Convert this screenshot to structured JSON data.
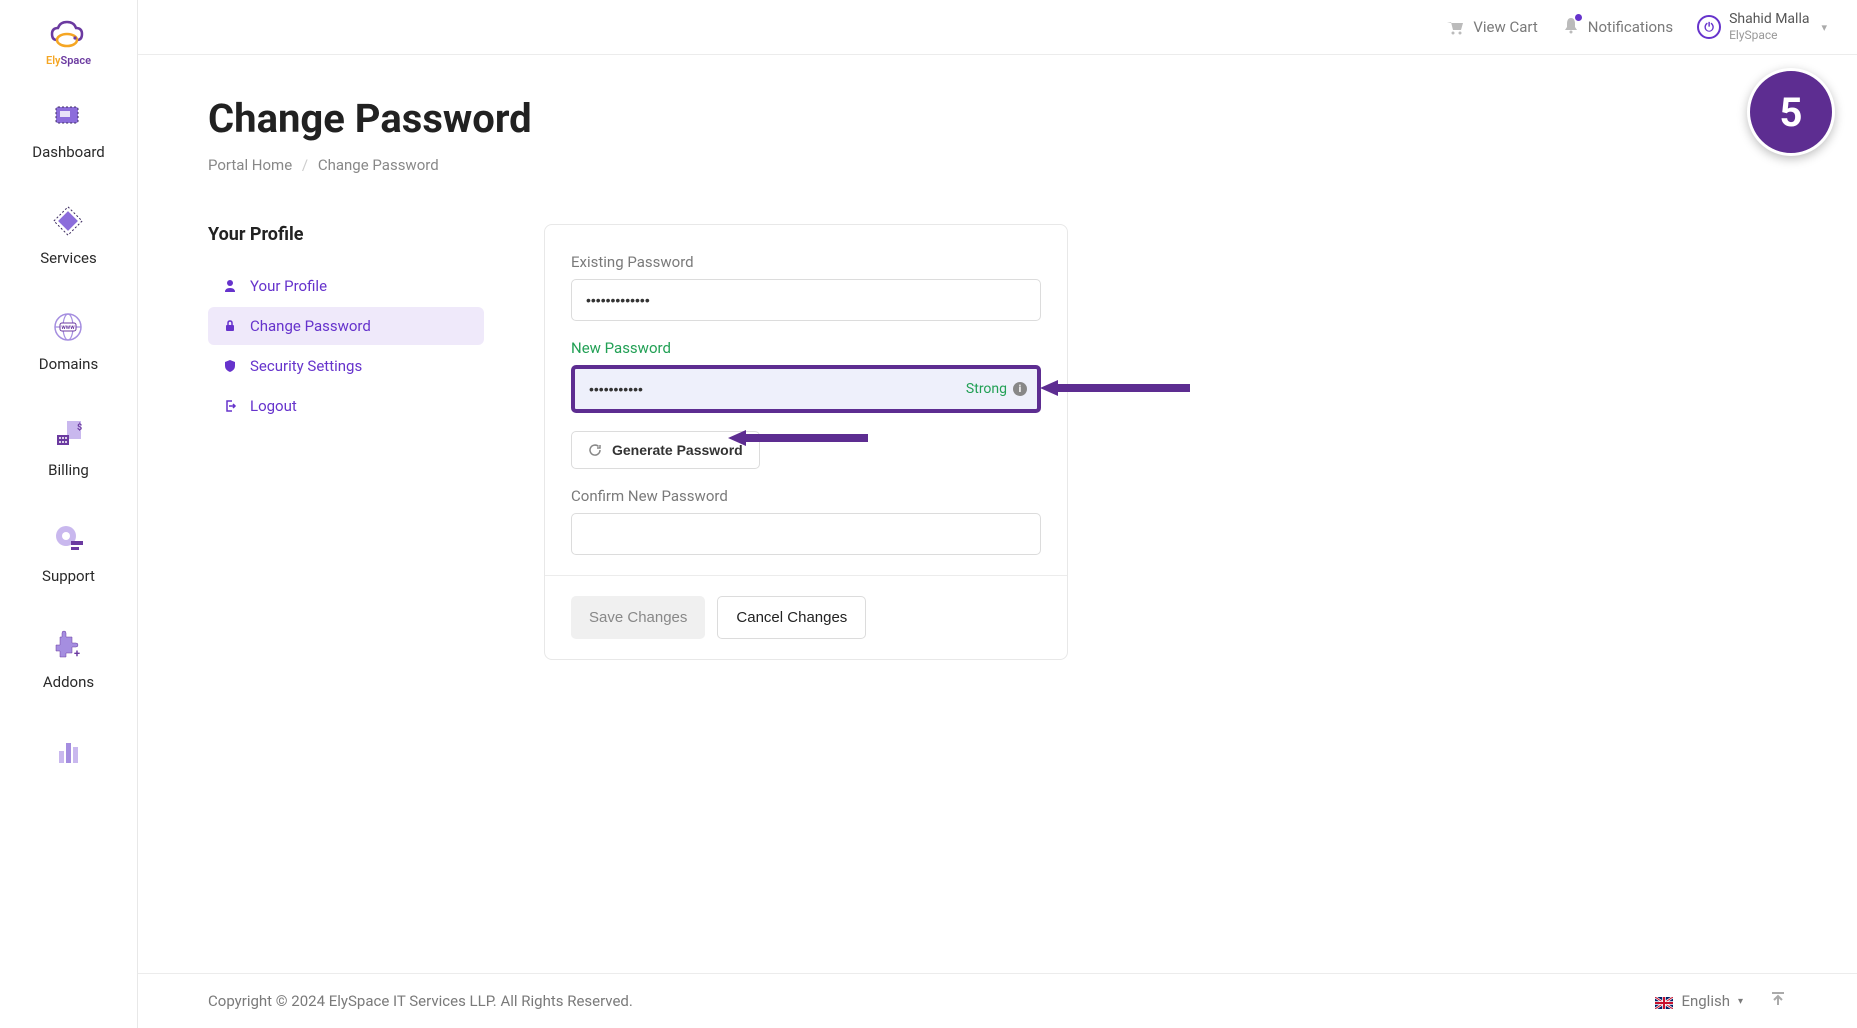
{
  "brand": {
    "name": "ElySpace"
  },
  "sidebar": {
    "items": [
      {
        "label": "Dashboard"
      },
      {
        "label": "Services"
      },
      {
        "label": "Domains"
      },
      {
        "label": "Billing"
      },
      {
        "label": "Support"
      },
      {
        "label": "Addons"
      }
    ]
  },
  "topbar": {
    "view_cart": "View Cart",
    "notifications": "Notifications",
    "user": {
      "name": "Shahid Malla",
      "sub": "ElySpace"
    }
  },
  "page": {
    "title": "Change Password",
    "breadcrumb": {
      "home": "Portal Home",
      "current": "Change Password"
    }
  },
  "side_menu": {
    "title": "Your Profile",
    "items": [
      {
        "label": "Your Profile"
      },
      {
        "label": "Change Password"
      },
      {
        "label": "Security Settings"
      },
      {
        "label": "Logout"
      }
    ]
  },
  "form": {
    "existing_label": "Existing Password",
    "existing_value": "•••••••••••••",
    "new_label": "New Password",
    "new_value": "•••••••••••",
    "strength": "Strong",
    "generate_label": "Generate Password",
    "confirm_label": "Confirm New Password",
    "confirm_value": "",
    "save_label": "Save Changes",
    "cancel_label": "Cancel Changes"
  },
  "step_badge": "5",
  "footer": {
    "copyright": "Copyright © 2024 ElySpace IT Services LLP. All Rights Reserved.",
    "language": "English"
  },
  "colors": {
    "accent": "#6633cc",
    "dark_purple": "#5d2d91",
    "success": "#22a055"
  }
}
